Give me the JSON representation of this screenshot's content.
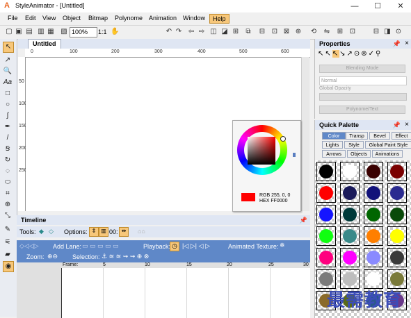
{
  "window": {
    "app_name": "StyleAnimator",
    "document": "[Untitled]",
    "minimize": "—",
    "maximize": "☐",
    "close": "✕"
  },
  "menu": [
    "File",
    "Edit",
    "View",
    "Object",
    "Bitmap",
    "Polynome",
    "Animation",
    "Window",
    "Help"
  ],
  "toolbar": {
    "zoom_value": "100%",
    "ratio_label": "1:1"
  },
  "document": {
    "tab_label": "Untitled",
    "h_ruler": [
      "0",
      "100",
      "200",
      "300",
      "400",
      "500",
      "600"
    ],
    "v_ruler": [
      "50",
      "100",
      "150",
      "200",
      "250"
    ]
  },
  "color_picker": {
    "rgb_label": "RGB 255, 0, 0",
    "hex_label": "HEX FF0000",
    "current_color": "#ff0000"
  },
  "timeline": {
    "title": "Timeline",
    "tools_label": "Tools:",
    "options_label": "Options:",
    "onion_label": "00:",
    "add_lane_label": "Add Lane:",
    "playback_label": "Playback:",
    "animated_texture_label": "Animated Texture:",
    "zoom_label": "Zoom:",
    "selection_label": "Selection:",
    "frame_label": "Frame:",
    "frame_numbers": [
      "5",
      "10",
      "15",
      "20",
      "25",
      "30"
    ]
  },
  "properties": {
    "title": "Properties",
    "blending_mode": "Blending Mode",
    "normal": "Normal",
    "global_opacity": "Global Opacity",
    "polynome_text": "Polynome/Text"
  },
  "quick_palette": {
    "title": "Quick Palette",
    "tabs_row1": [
      "Color",
      "Transp",
      "Bevel",
      "Effect"
    ],
    "tabs_row2": [
      "Lights",
      "Style",
      "Global Paint Style"
    ],
    "tabs_row3": [
      "Arrows",
      "Objects",
      "Animations"
    ],
    "swatches": [
      "#000000",
      "#ffffff",
      "#3a0000",
      "#7a0000",
      "#ff0000",
      "#1a1a5a",
      "#12127a",
      "#2a2a90",
      "#1515ff",
      "#003a3a",
      "#006600",
      "#0a4a0a",
      "#10ff10",
      "#3a8a8a",
      "#ff7f00",
      "#ffff00",
      "#ff007f",
      "#ff00ff",
      "#8a8aff",
      "#3a3a3a",
      "#7a7a7a",
      "#bdbdbd",
      "#ffffff",
      "#7a7a3a",
      "#8a6a2a",
      "#5a6a1a",
      "#2a5a8a",
      "#6a3a8a"
    ]
  },
  "watermark": "最需教育"
}
